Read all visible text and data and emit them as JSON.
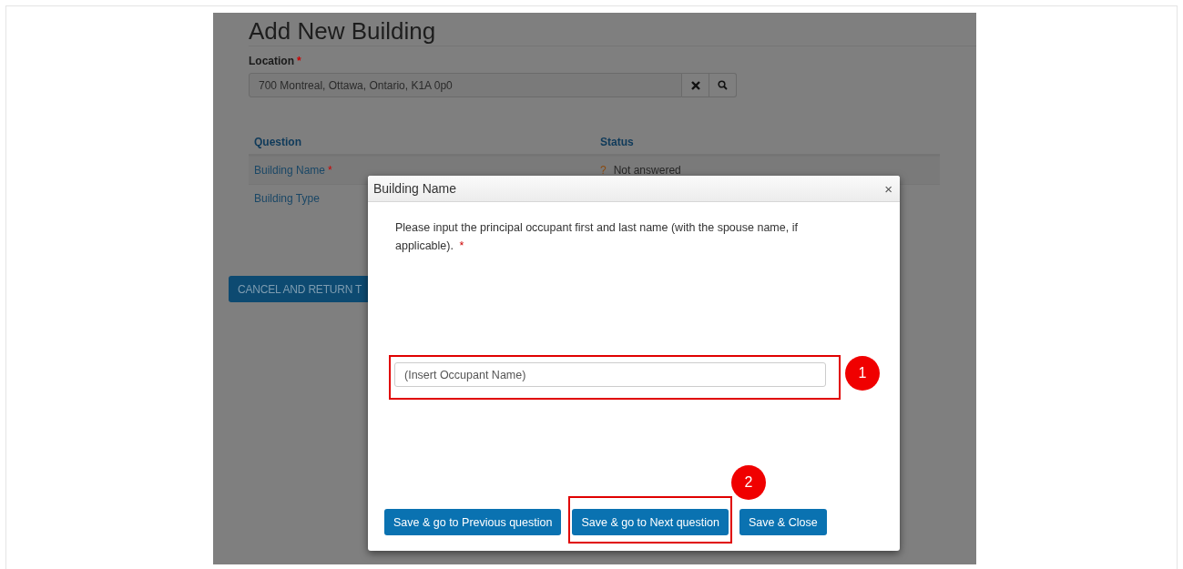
{
  "page": {
    "title": "Add New Building",
    "location": {
      "label": "Location",
      "required_mark": "*",
      "value": "700  Montreal, Ottawa, Ontario, K1A 0p0"
    },
    "table": {
      "columns": [
        "Question",
        "Status"
      ],
      "rows": [
        {
          "question": "Building Name",
          "required_mark": "*",
          "status_icon": "?",
          "status": "Not answered"
        },
        {
          "question": "Building Type"
        }
      ]
    },
    "cancel_button": "CANCEL AND RETURN T"
  },
  "dialog": {
    "title": "Building Name",
    "close": "×",
    "prompt": "Please input the principal occupant first and last name (with the spouse name, if applicable).",
    "required_mark": "*",
    "field": {
      "placeholder": "(Insert Occupant Name)"
    },
    "buttons": [
      "Save & go to Previous question",
      "Save & go to Next question",
      "Save & Close"
    ]
  },
  "callouts": [
    {
      "number": "1"
    },
    {
      "number": "2"
    }
  ]
}
